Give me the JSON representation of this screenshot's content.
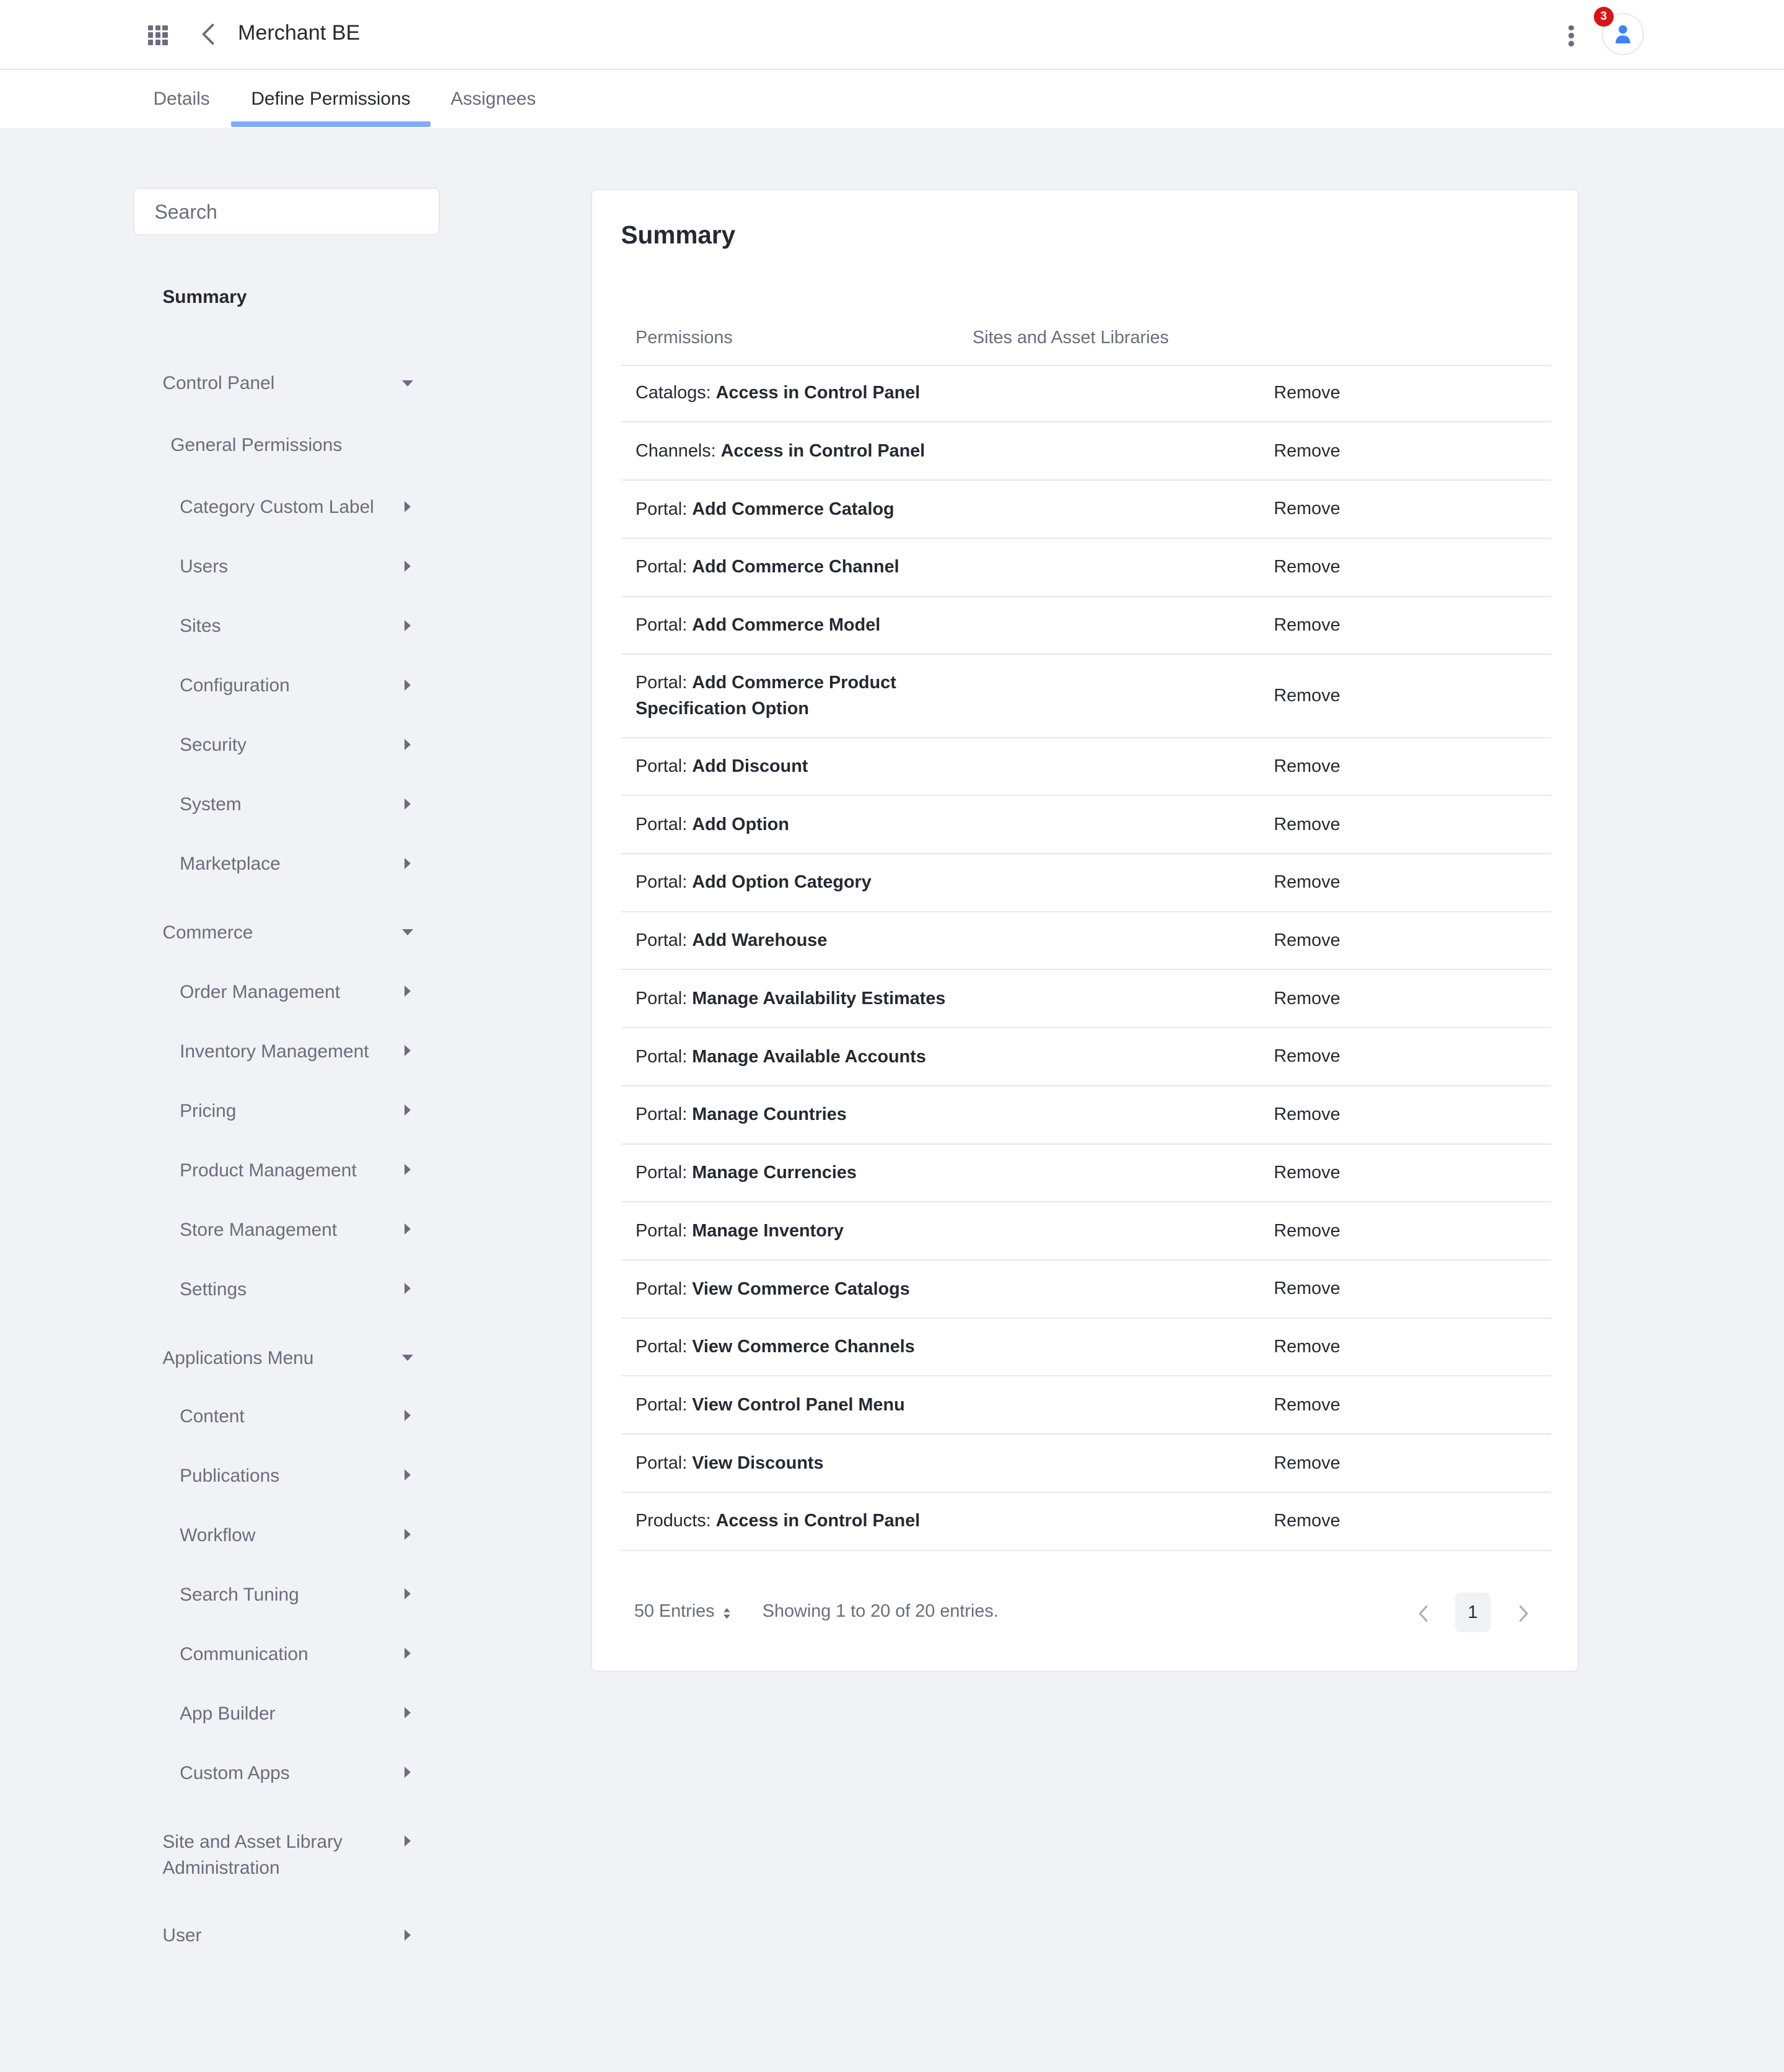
{
  "header": {
    "title": "Merchant BE",
    "notification_count": "3"
  },
  "tabs": [
    {
      "label": "Details",
      "active": false
    },
    {
      "label": "Define Permissions",
      "active": true
    },
    {
      "label": "Assignees",
      "active": false
    }
  ],
  "sidebar": {
    "search_placeholder": "Search",
    "summary": "Summary",
    "control_panel": {
      "label": "Control Panel",
      "general_permissions": "General Permissions",
      "items": [
        "Category Custom Label",
        "Users",
        "Sites",
        "Configuration",
        "Security",
        "System",
        "Marketplace"
      ]
    },
    "commerce": {
      "label": "Commerce",
      "items": [
        "Order Management",
        "Inventory Management",
        "Pricing",
        "Product Management",
        "Store Management",
        "Settings"
      ]
    },
    "applications_menu": {
      "label": "Applications Menu",
      "items": [
        "Content",
        "Publications",
        "Workflow",
        "Search Tuning",
        "Communication",
        "App Builder",
        "Custom Apps"
      ]
    },
    "site_admin": {
      "line1": "Site and Asset Library",
      "line2": "Administration"
    },
    "user": "User"
  },
  "summary": {
    "title": "Summary",
    "columns": [
      "Permissions",
      "Sites and Asset Libraries"
    ],
    "remove_label": "Remove",
    "rows": [
      {
        "prefix": "Catalogs: ",
        "name": "Access in Control Panel"
      },
      {
        "prefix": "Channels: ",
        "name": "Access in Control Panel"
      },
      {
        "prefix": "Portal: ",
        "name": "Add Commerce Catalog"
      },
      {
        "prefix": "Portal: ",
        "name": "Add Commerce Channel"
      },
      {
        "prefix": "Portal: ",
        "name": "Add Commerce Model"
      },
      {
        "prefix": "Portal: ",
        "name": "Add Commerce Product Specification Option"
      },
      {
        "prefix": "Portal: ",
        "name": "Add Discount"
      },
      {
        "prefix": "Portal: ",
        "name": "Add Option"
      },
      {
        "prefix": "Portal: ",
        "name": "Add Option Category"
      },
      {
        "prefix": "Portal: ",
        "name": "Add Warehouse"
      },
      {
        "prefix": "Portal: ",
        "name": "Manage Availability Estimates"
      },
      {
        "prefix": "Portal: ",
        "name": "Manage Available Accounts"
      },
      {
        "prefix": "Portal: ",
        "name": "Manage Countries"
      },
      {
        "prefix": "Portal: ",
        "name": "Manage Currencies"
      },
      {
        "prefix": "Portal: ",
        "name": "Manage Inventory"
      },
      {
        "prefix": "Portal: ",
        "name": "View Commerce Catalogs"
      },
      {
        "prefix": "Portal: ",
        "name": "View Commerce Channels"
      },
      {
        "prefix": "Portal: ",
        "name": "View Control Panel Menu"
      },
      {
        "prefix": "Portal: ",
        "name": "View Discounts"
      },
      {
        "prefix": "Products: ",
        "name": "Access in Control Panel"
      }
    ],
    "footer": {
      "entries_label": "50 Entries",
      "showing": "Showing 1 to 20 of 20 entries.",
      "current_page": "1"
    }
  }
}
